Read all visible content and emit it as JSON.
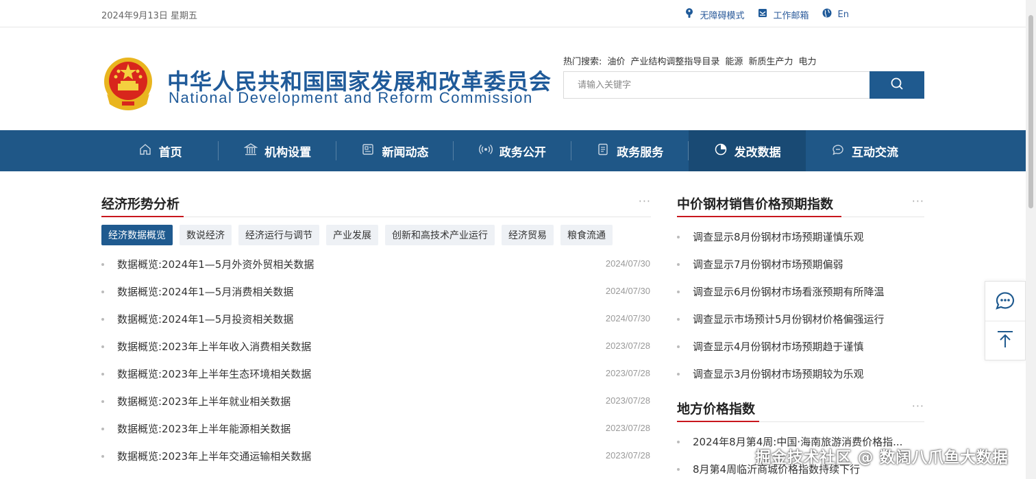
{
  "topbar": {
    "date": "2024年9月13日  星期五",
    "links": [
      {
        "label": "无障碍模式",
        "icon": "accessibility-icon"
      },
      {
        "label": "工作邮箱",
        "icon": "mail-icon"
      },
      {
        "label": "En",
        "icon": "globe-icon"
      }
    ]
  },
  "header": {
    "title_cn": "中华人民共和国国家发展和改革委员会",
    "title_en": "National Development and Reform Commission",
    "hot_label": "热门搜索:",
    "hot_items": [
      "油价",
      "产业结构调整指导目录",
      "能源",
      "新质生产力",
      "电力"
    ],
    "search_placeholder": "请输入关键字"
  },
  "nav": {
    "items": [
      {
        "label": "首页",
        "icon": "home-icon"
      },
      {
        "label": "机构设置",
        "icon": "institution-icon"
      },
      {
        "label": "新闻动态",
        "icon": "news-icon"
      },
      {
        "label": "政务公开",
        "icon": "broadcast-icon"
      },
      {
        "label": "政务服务",
        "icon": "document-icon"
      },
      {
        "label": "发改数据",
        "icon": "pie-chart-icon",
        "active": true
      },
      {
        "label": "互动交流",
        "icon": "chat-icon"
      }
    ],
    "active_color": "#194a74",
    "bar_color": "#1f5787"
  },
  "left": {
    "title": "经济形势分析",
    "more": "···",
    "tabs": [
      "经济数据概览",
      "数说经济",
      "经济运行与调节",
      "产业发展",
      "创新和高技术产业运行",
      "经济贸易",
      "粮食流通"
    ],
    "active_tab": 0,
    "news": [
      {
        "title": "数据概览:2024年1—5月外资外贸相关数据",
        "date": "2024/07/30"
      },
      {
        "title": "数据概览:2024年1—5月消费相关数据",
        "date": "2024/07/30"
      },
      {
        "title": "数据概览:2024年1—5月投资相关数据",
        "date": "2024/07/30"
      },
      {
        "title": "数据概览:2023年上半年收入消费相关数据",
        "date": "2023/07/28"
      },
      {
        "title": "数据概览:2023年上半年生态环境相关数据",
        "date": "2023/07/28"
      },
      {
        "title": "数据概览:2023年上半年就业相关数据",
        "date": "2023/07/28"
      },
      {
        "title": "数据概览:2023年上半年能源相关数据",
        "date": "2023/07/28"
      },
      {
        "title": "数据概览:2023年上半年交通运输相关数据",
        "date": "2023/07/28"
      }
    ]
  },
  "right": {
    "steel": {
      "title": "中价钢材销售价格预期指数",
      "more": "···",
      "items": [
        "调查显示8月份钢材市场预期谨慎乐观",
        "调查显示7月份钢材市场预期偏弱",
        "调查显示6月份钢材市场看涨预期有所降温",
        "调查显示市场预计5月份钢材价格偏强运行",
        "调查显示4月份钢材市场预期趋于谨慎",
        "调查显示3月份钢材市场预期较为乐观"
      ]
    },
    "local": {
      "title": "地方价格指数",
      "more": "···",
      "items": [
        "2024年8月第4周:中国·海南旅游消费价格指...",
        "8月第4周临沂商城价格指数持续下行"
      ]
    }
  },
  "watermark": "掘金技术社区 @ 数阔八爪鱼大数据",
  "colors": {
    "brand_blue": "#1f5a99",
    "accent_red": "#c8161d"
  }
}
